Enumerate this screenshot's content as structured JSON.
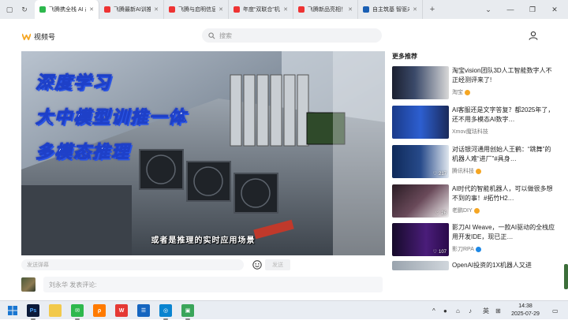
{
  "browser": {
    "tabs": [
      {
        "title": "飞腾携全栈 AI 产",
        "active": true,
        "color": "#2db84d"
      },
      {
        "title": "飞腾最新AI训推一体",
        "active": false,
        "color": "#e33"
      },
      {
        "title": "飞腾与启明信息战略",
        "active": false,
        "color": "#e33"
      },
      {
        "title": "年度“双联合”机制",
        "active": false,
        "color": "#e33"
      },
      {
        "title": "飞腾新品亮相！快来",
        "active": false,
        "color": "#e33"
      },
      {
        "title": "自主筑基 智驱未来",
        "active": false,
        "color": "#1a5fb4"
      }
    ],
    "new_tab": "+",
    "controls": {
      "minimize": "—",
      "restore": "❐",
      "close": "✕"
    }
  },
  "header": {
    "logo_text": "视频号",
    "logo_color": "#f5a623",
    "search_placeholder": "搜索"
  },
  "video": {
    "caption_lines": [
      "深度学习",
      "大中模型训推一体",
      "多模态推理"
    ],
    "subtitle": "或者是推理的实时应用场景"
  },
  "danmaku": {
    "placeholder": "发送弹幕",
    "send_label": "发送"
  },
  "comment": {
    "placeholder": "刘永华 发表评论:"
  },
  "recommendations": {
    "title": "更多推荐",
    "items": [
      {
        "title": "淘宝vision团队3D人工智能数字人不正经测评来了!",
        "author": "淘宝",
        "likes": "",
        "thumb": "a",
        "verified": "#f5a623"
      },
      {
        "title": "AI客服还是文字答复？都2025年了，还不用多模态AI数字…",
        "author": "Xmov魔珐科技",
        "likes": "",
        "thumb": "b",
        "verified": ""
      },
      {
        "title": "对话银河通用创始人王鹤：“跳舞”的机器人难“进厂”#具身…",
        "author": "腾讯科技",
        "likes": "217",
        "thumb": "c",
        "verified": "#f5a623"
      },
      {
        "title": "AI时代的智能机器人，可以做很多想不到的事！#拓竹H2…",
        "author": "老鹏DIY",
        "likes": "26",
        "thumb": "d",
        "verified": "#f5a623"
      },
      {
        "title": "影刀AI Weave，一款AI驱动的全栈应用开发IDE，现已正…",
        "author": "影刀RPA",
        "likes": "107",
        "thumb": "e",
        "verified": "#1e88e5"
      },
      {
        "title": "OpenAI投资的1X机器人又进",
        "author": "",
        "likes": "",
        "thumb": "f",
        "verified": ""
      }
    ]
  },
  "taskbar": {
    "ime": "英",
    "time": "14:38",
    "date": "2025-07-29",
    "chevron": "^"
  }
}
